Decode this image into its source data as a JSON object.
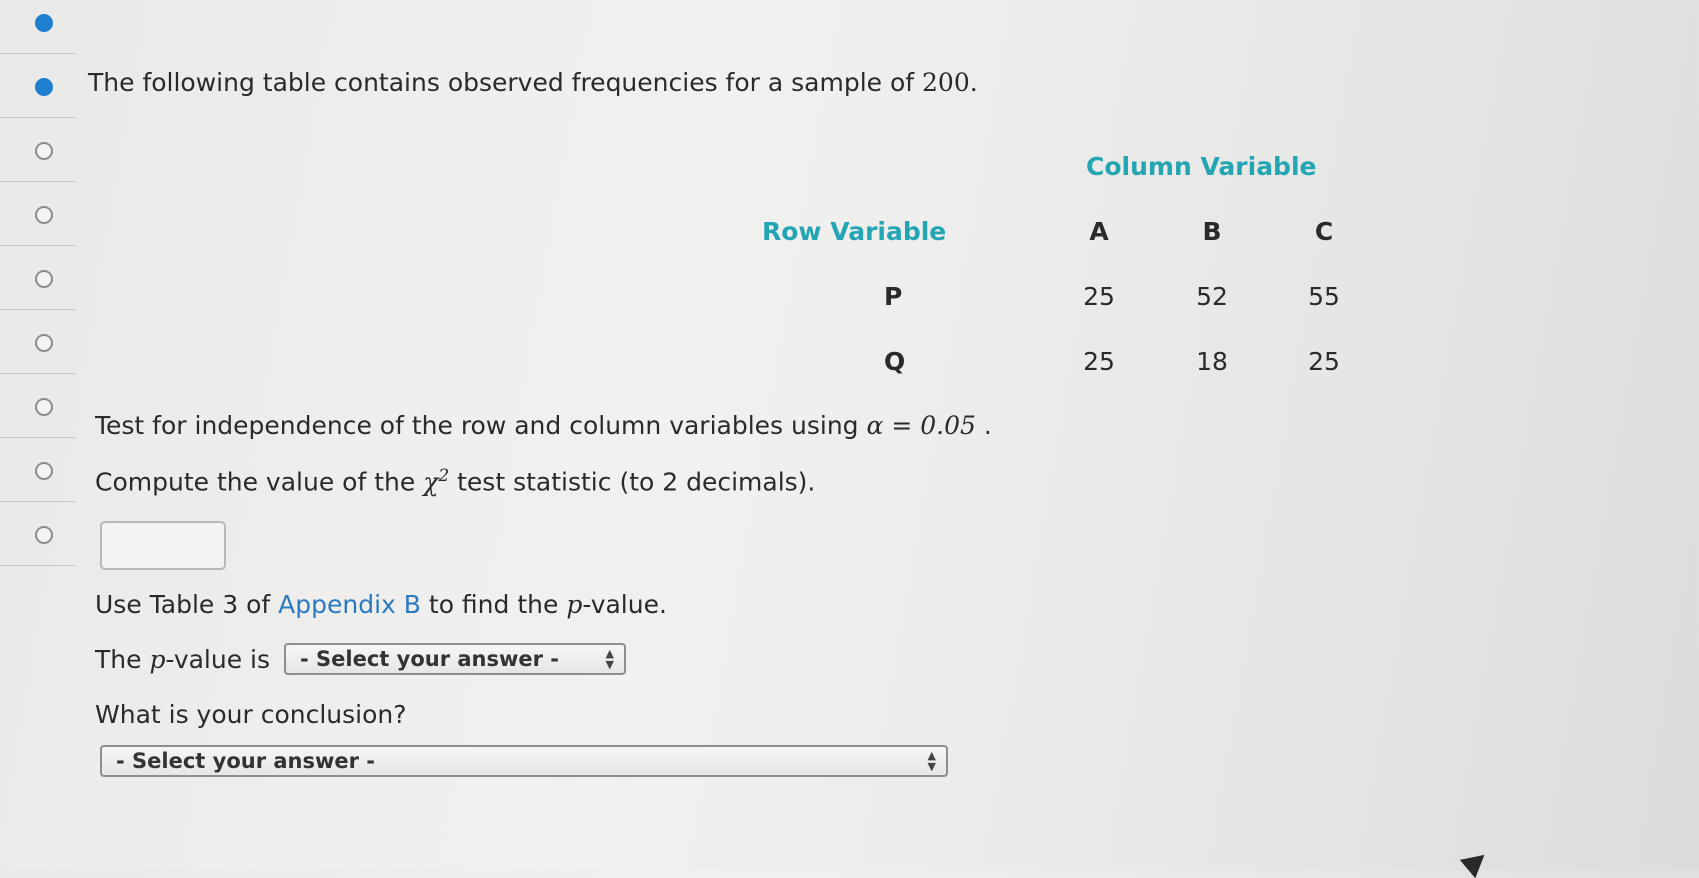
{
  "intro": {
    "text": "The following table contains observed frequencies for a sample of",
    "sample": "200",
    "period": "."
  },
  "table": {
    "column_variable_label": "Column Variable",
    "row_variable_label": "Row Variable",
    "columns": [
      "A",
      "B",
      "C"
    ],
    "rows": [
      {
        "label": "P",
        "values": [
          "25",
          "52",
          "55"
        ]
      },
      {
        "label": "Q",
        "values": [
          "25",
          "18",
          "25"
        ]
      }
    ]
  },
  "test_line": {
    "text": "Test for independence of the row and column variables using",
    "alpha_expr": "α = 0.05",
    "tail": " ."
  },
  "compute_line": {
    "pre": "Compute the value of the",
    "chi": "χ",
    "sup": "2",
    "post": "test statistic (to 2 decimals)."
  },
  "answer_input": {
    "value": ""
  },
  "appendix_line": {
    "pre": "Use Table 3 of",
    "link": "Appendix B",
    "mid": "to find the",
    "p": "p",
    "post": "-value."
  },
  "pvalue_line": {
    "pre": "The",
    "p": "p",
    "post": "-value is",
    "select": "- Select your answer -"
  },
  "conclusion": {
    "question": "What is your conclusion?",
    "select": "- Select your answer -"
  },
  "sidebar": {
    "steps": [
      {
        "state": "filled"
      },
      {
        "state": "filled"
      },
      {
        "state": "empty"
      },
      {
        "state": "empty"
      },
      {
        "state": "empty"
      },
      {
        "state": "empty"
      },
      {
        "state": "empty"
      },
      {
        "state": "empty"
      },
      {
        "state": "empty"
      }
    ]
  },
  "colors": {
    "accent": "#24a5b4",
    "link": "#2b79c2",
    "filled_step": "#1f7fd0"
  }
}
